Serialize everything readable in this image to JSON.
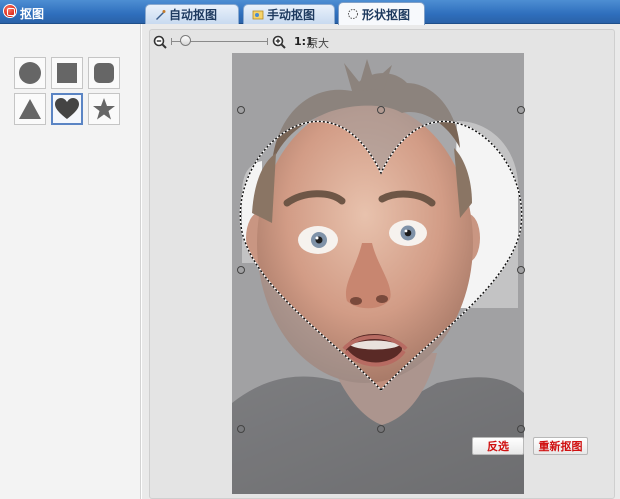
{
  "window": {
    "title": "抠图"
  },
  "tabs": [
    {
      "label": "自动抠图",
      "icon": "brush-icon"
    },
    {
      "label": "手动抠图",
      "icon": "manual-cutout-icon"
    },
    {
      "label": "形状抠图",
      "icon": "shape-cutout-icon",
      "active": true
    }
  ],
  "shapes": [
    {
      "name": "circle",
      "selected": false
    },
    {
      "name": "square",
      "selected": false
    },
    {
      "name": "rounded-square",
      "selected": false
    },
    {
      "name": "triangle",
      "selected": false
    },
    {
      "name": "heart",
      "selected": true
    },
    {
      "name": "star",
      "selected": false
    }
  ],
  "zoom": {
    "ratio": "1:1",
    "ratio_desc": "原大",
    "slider_level": 0.12
  },
  "canvas": {
    "selection_shape": "heart",
    "image": "photo of a surprised man against a grey background"
  },
  "actions": {
    "invert": "反选",
    "redo": "重新抠图"
  },
  "colors": {
    "accent": "#2f6fbd",
    "selection": "#4a78c4",
    "action_text": "#d01010"
  }
}
